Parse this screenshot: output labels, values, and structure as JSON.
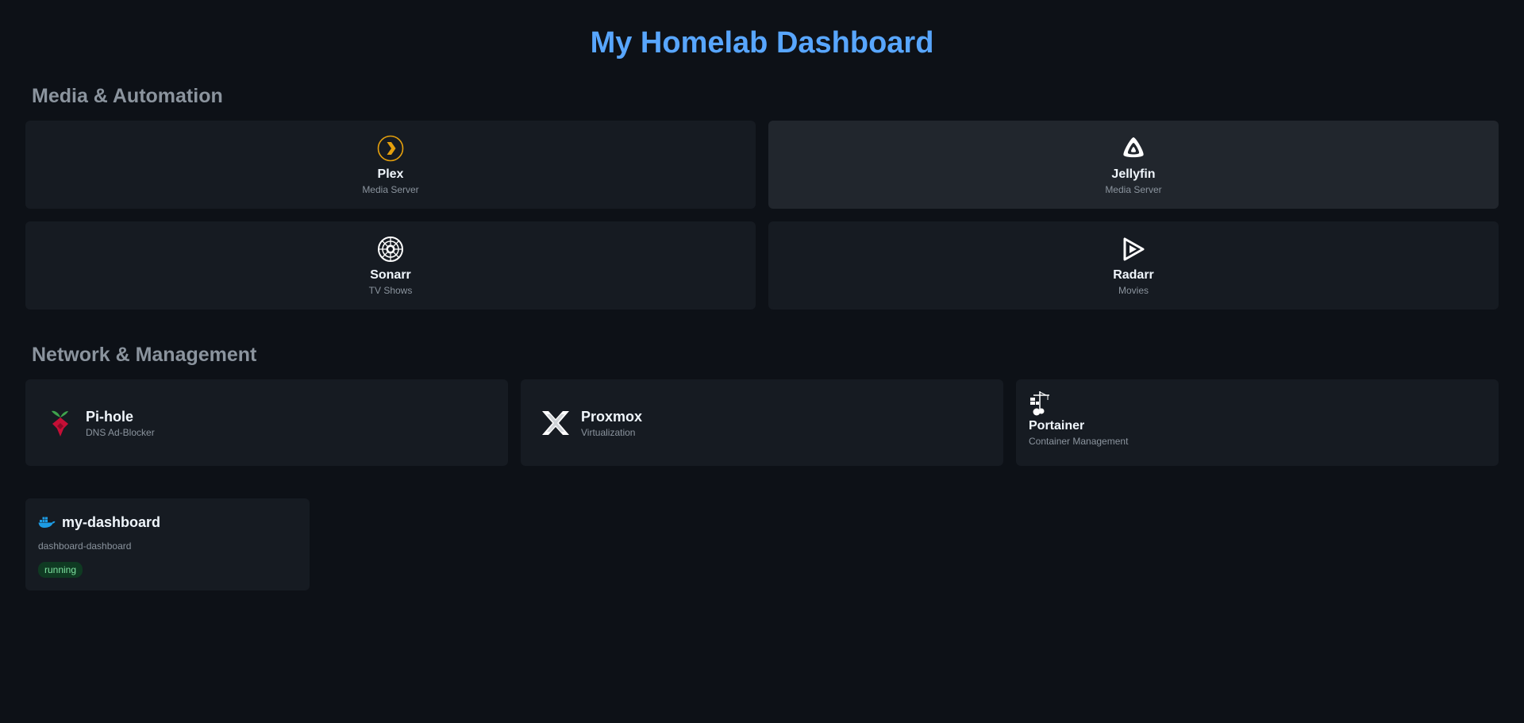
{
  "header": {
    "title": "My Homelab Dashboard"
  },
  "sections": {
    "media": {
      "title": "Media & Automation",
      "items": [
        {
          "name": "Plex",
          "description": "Media Server",
          "icon": "plex-icon"
        },
        {
          "name": "Jellyfin",
          "description": "Media Server",
          "icon": "jellyfin-icon"
        },
        {
          "name": "Sonarr",
          "description": "TV Shows",
          "icon": "sonarr-icon"
        },
        {
          "name": "Radarr",
          "description": "Movies",
          "icon": "radarr-icon"
        }
      ]
    },
    "network": {
      "title": "Network & Management",
      "items": [
        {
          "name": "Pi-hole",
          "description": "DNS Ad-Blocker",
          "icon": "pihole-icon"
        },
        {
          "name": "Proxmox",
          "description": "Virtualization",
          "icon": "proxmox-icon"
        },
        {
          "name": "Portainer",
          "description": "Container Management",
          "icon": "portainer-icon"
        }
      ]
    }
  },
  "containers": [
    {
      "name": "my-dashboard",
      "image": "dashboard-dashboard",
      "status": "running",
      "icon": "docker-icon"
    }
  ],
  "colors": {
    "background": "#0d1117",
    "card": "#161b22",
    "card_hover": "#21262d",
    "title": "#58a6ff",
    "section_title": "#8b949e",
    "status_running_bg": "#0f3a22",
    "status_running_text": "#7ee2a0",
    "plex": "#e5a00d",
    "pihole_red": "#c50f36",
    "pihole_green": "#3fa34d",
    "docker": "#1d9ce5"
  }
}
